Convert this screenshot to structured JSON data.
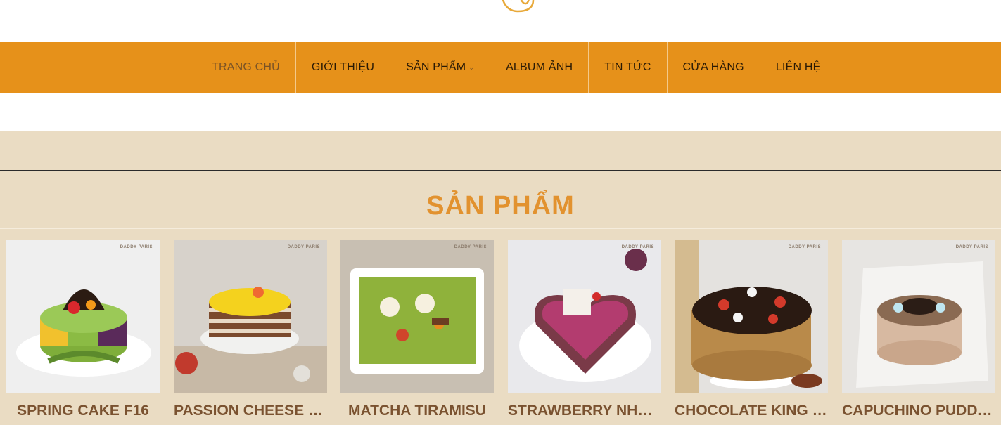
{
  "nav": {
    "items": [
      {
        "label": "TRANG CHỦ",
        "active": true
      },
      {
        "label": "GIỚI THIỆU"
      },
      {
        "label": "SẢN PHẨM",
        "dropdown": true
      },
      {
        "label": "ALBUM ẢNH"
      },
      {
        "label": "TIN TỨC"
      },
      {
        "label": "CỬA HÀNG"
      },
      {
        "label": "LIÊN HỆ"
      }
    ]
  },
  "section": {
    "title": "SẢN PHẨM"
  },
  "products": [
    {
      "name": "SPRING CAKE F16",
      "watermark": "DADDY PARIS"
    },
    {
      "name": "PASSION CHEESE MOUSSE",
      "watermark": "DADDY PARIS"
    },
    {
      "name": "MATCHA TIRAMISU",
      "watermark": "DADDY PARIS"
    },
    {
      "name": "STRAWBERRY NHANH",
      "watermark": "DADDY PARIS"
    },
    {
      "name": "CHOCOLATE KING CAKE",
      "watermark": "DADDY PARIS"
    },
    {
      "name": "CAPUCHINO PUDDING",
      "watermark": "DADDY PARIS"
    }
  ],
  "colors": {
    "nav_bg": "#e6911a",
    "section_bg": "#eadcc3",
    "title": "#e2922f",
    "product_name": "#7a5230"
  }
}
